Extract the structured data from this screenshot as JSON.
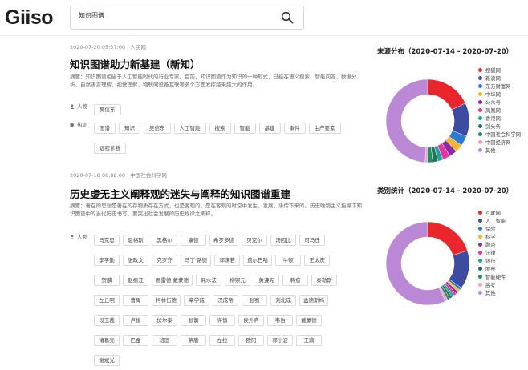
{
  "logo": {
    "text": "Giiso"
  },
  "search": {
    "value": "知识图谱"
  },
  "articles": [
    {
      "meta": "2020-07-20 05:57:00 | 人民网",
      "title": "知识图谱助力新基建（新知）",
      "abstract": "摘要：知识图谱相当于人工智能时代的行业专家。目前，知识图谱作为知识的一种形式，已经在语义搜索、智能问答、数据分析、自然语言理解、视觉理解、物联网设备互联等多个方面发挥越来越大的作用。",
      "people_label": "人物",
      "people": [
        "吴信东"
      ],
      "hot_label": "热词",
      "hot": [
        "图谱",
        "知识",
        "吴信东",
        "人工智能",
        "搜索",
        "智能",
        "基建",
        "事件",
        "生产要素",
        "远程诊断"
      ]
    },
    {
      "meta": "2020-07-18 08:08:00 | 中国社会科学网",
      "title": "历史虚无主义阐释观的迷失与阐释的知识图谱重建",
      "abstract": "摘要：著在的思想是著在的存物质存在方式，也是客观的，是在客观的时空中发生、发展、承传下来的。历史唯物主义指导下知识图谱中的当代历史书写，要突出社会发展的历史规律之阐释。",
      "people_label": "人物",
      "people": [
        "马克思",
        "恩格斯",
        "黑格尔",
        "康德",
        "希罗多德",
        "贝克尔",
        "汤因比",
        "司马迁",
        "李学勤",
        "张政文",
        "克罗齐",
        "马丁·路德",
        "郭沫若",
        "费尔巴哈",
        "牛顿",
        "王太庆",
        "贺麟",
        "赵振江",
        "贾雷德·戴蒙德",
        "耗水法",
        "柳宗元",
        "黄遵宪",
        "韩愈",
        "泰勒斯",
        "左丘明",
        "曹禺",
        "柯林伍德",
        "章学诚",
        "汉成帝",
        "张骞",
        "刘北成",
        "孟德斯鸠",
        "段玉裁",
        "卢梭",
        "伏尔泰",
        "张衡",
        "许慎",
        "侯外庐",
        "韦伯",
        "戴蒙德",
        "诸葛亮",
        "巴金",
        "班固",
        "茅盾",
        "左拉",
        "欧阳",
        "郭小波",
        "王鼎",
        "谢斌光"
      ]
    }
  ],
  "charts": [
    {
      "title": "来源分布（2020-07-14 - 2020-07-20）",
      "chart_data": {
        "type": "pie",
        "categories": [
          "搜狐网",
          "新浪网",
          "东方财富网",
          "中华网",
          "公众号",
          "凤凰网",
          "香港网",
          "剑头条",
          "中国社会科学网",
          "中国经济网",
          "其他"
        ],
        "values": [
          18,
          13,
          4,
          3,
          3,
          3,
          2,
          2,
          2,
          1,
          49
        ],
        "colors": [
          "#e8262c",
          "#3d4ca0",
          "#2b79d4",
          "#f6b62b",
          "#8a2bab",
          "#e7339c",
          "#1aa3a0",
          "#2c6e5a",
          "#1e8f5e",
          "#f29bc4",
          "#bb88d6"
        ]
      }
    },
    {
      "title": "类别统计（2020-07-14 - 2020-07-20）",
      "chart_data": {
        "type": "pie",
        "categories": [
          "互联网",
          "人工智能",
          "保险",
          "科学",
          "融资",
          "法律",
          "银行",
          "股票",
          "智能硬件",
          "高考",
          "其他"
        ],
        "values": [
          20,
          15,
          1,
          1,
          1,
          1,
          1,
          1,
          1,
          1,
          57
        ],
        "colors": [
          "#e8262c",
          "#3d4ca0",
          "#2b79d4",
          "#f6b62b",
          "#8a2bab",
          "#e7339c",
          "#1aa3a0",
          "#2c6e5a",
          "#1e8f5e",
          "#f29bc4",
          "#bb88d6"
        ]
      }
    }
  ]
}
